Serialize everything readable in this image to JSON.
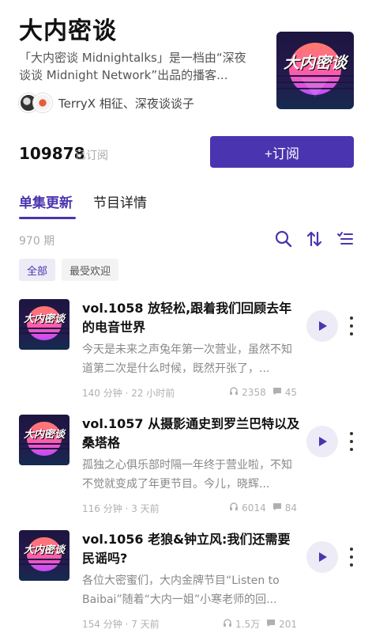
{
  "podcast": {
    "title": "大内密谈",
    "description": "「大内密谈 Midnightalks」是一档由“深夜谈谈 Midnight Network”出品的播客...",
    "hosts": "TerryX 相征、深夜谈谈子",
    "cover_logo": "大内密谈"
  },
  "subscription": {
    "count": "109878",
    "count_label": "已订阅",
    "button_label": "+订阅"
  },
  "tabs": [
    {
      "label": "单集更新",
      "active": true
    },
    {
      "label": "节目详情",
      "active": false
    }
  ],
  "toolbar": {
    "episode_count": "970 期",
    "icons": [
      "search-icon",
      "sort-icon",
      "filter-list-icon"
    ]
  },
  "filters": [
    {
      "label": "全部",
      "active": true
    },
    {
      "label": "最受欢迎",
      "active": false
    }
  ],
  "episodes": [
    {
      "title": "vol.1058 放轻松,跟着我们回顾去年的电音世界",
      "description": "今天是未来之声兔年第一次营业，虽然不知道第二次是什么时候，既然开张了，...",
      "duration": "140 分钟",
      "time_ago": "22 小时前",
      "plays": "2358",
      "comments": "45"
    },
    {
      "title": "vol.1057 从摄影通史到罗兰巴特以及桑塔格",
      "description": "孤独之心俱乐部时隔一年终于营业啦，不知不觉就变成了年更节目。今儿，晓辉...",
      "duration": "116 分钟",
      "time_ago": "3 天前",
      "plays": "6014",
      "comments": "84"
    },
    {
      "title": "vol.1056 老狼&钟立风:我们还需要民谣吗?",
      "description": "各位大密蜜们，大内金牌节目“Listen to Baibai”随着“大内一姐”小寒老师的回...",
      "duration": "154 分钟",
      "time_ago": "7 天前",
      "plays": "1.5万",
      "comments": "201"
    }
  ],
  "colors": {
    "accent": "#4b34b0",
    "accent_light": "#ecebf6",
    "muted_text": "#b0b0b0"
  }
}
